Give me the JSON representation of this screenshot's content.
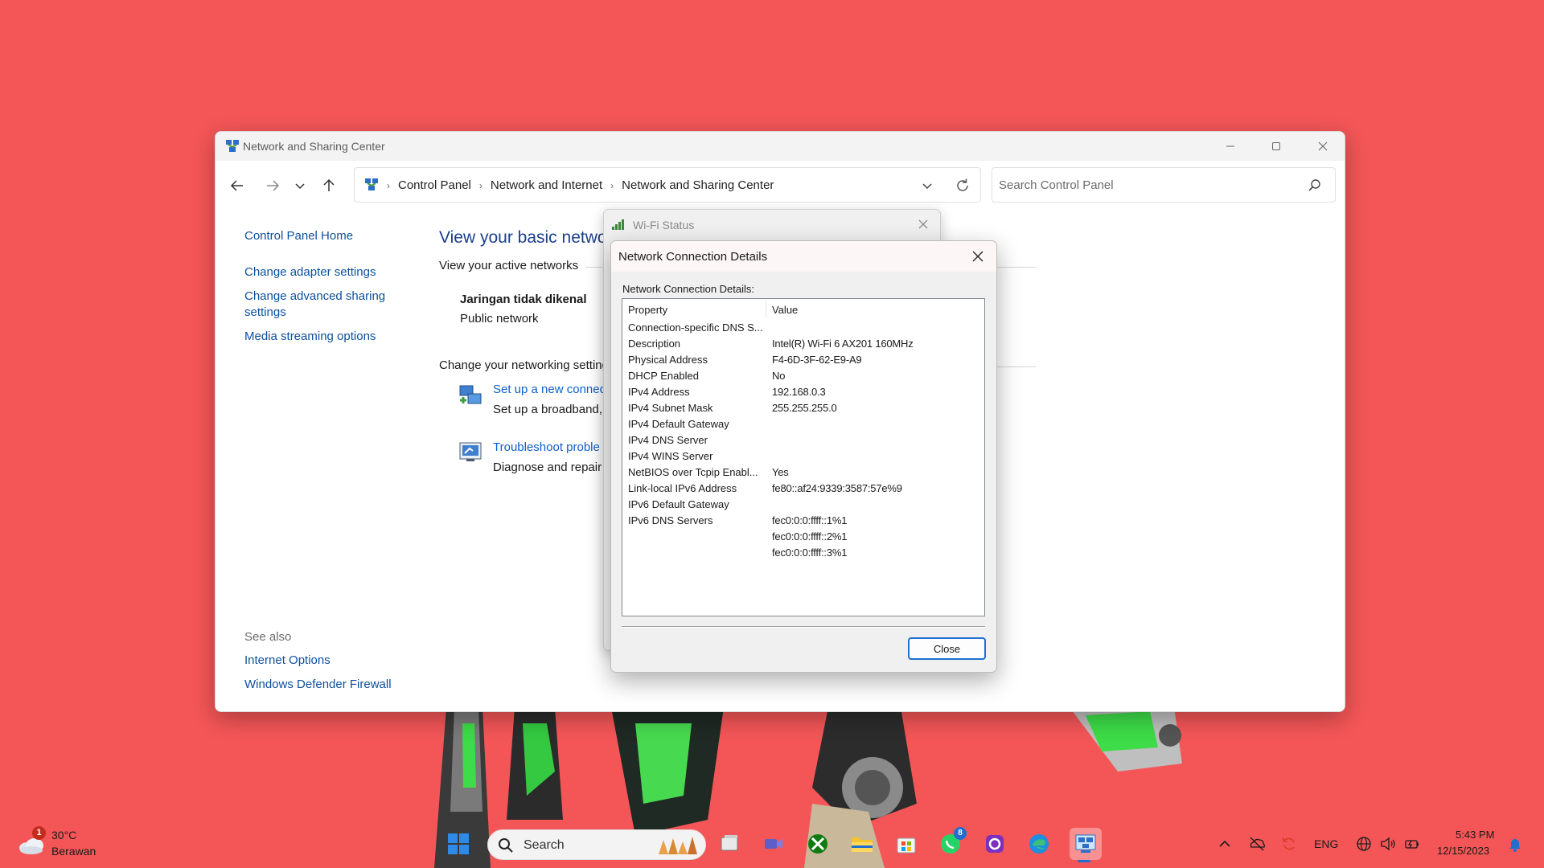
{
  "window": {
    "title": "Network and Sharing Center",
    "breadcrumbs": [
      "Control Panel",
      "Network and Internet",
      "Network and Sharing Center"
    ],
    "search_placeholder": "Search Control Panel"
  },
  "left_pane": {
    "links": [
      "Control Panel Home",
      "Change adapter settings",
      "Change advanced sharing settings",
      "Media streaming options"
    ],
    "see_also_title": "See also",
    "see_also": [
      "Internet Options",
      "Windows Defender Firewall"
    ]
  },
  "content": {
    "heading": "View your basic networ",
    "active_networks_label": "View your active networks",
    "network_name": "Jaringan tidak dikenal",
    "network_type": "Public network",
    "change_settings_label": "Change your networking setting",
    "tasks": [
      {
        "link": "Set up a new connec",
        "desc": "Set up a broadband,"
      },
      {
        "link": "Troubleshoot proble",
        "desc": "Diagnose and repair"
      }
    ]
  },
  "wifi_dialog": {
    "title": "Wi-Fi Status"
  },
  "details_dialog": {
    "title": "Network Connection Details",
    "label": "Network Connection Details:",
    "columns": [
      "Property",
      "Value"
    ],
    "rows": [
      [
        "Connection-specific DNS S...",
        ""
      ],
      [
        "Description",
        "Intel(R) Wi-Fi 6 AX201 160MHz"
      ],
      [
        "Physical Address",
        "F4-6D-3F-62-E9-A9"
      ],
      [
        "DHCP Enabled",
        "No"
      ],
      [
        "IPv4 Address",
        "192.168.0.3"
      ],
      [
        "IPv4 Subnet Mask",
        "255.255.255.0"
      ],
      [
        "IPv4 Default Gateway",
        ""
      ],
      [
        "IPv4 DNS Server",
        ""
      ],
      [
        "IPv4 WINS Server",
        ""
      ],
      [
        "NetBIOS over Tcpip Enabl...",
        "Yes"
      ],
      [
        "Link-local IPv6 Address",
        "fe80::af24:9339:3587:57e%9"
      ],
      [
        "IPv6 Default Gateway",
        ""
      ],
      [
        "IPv6 DNS Servers",
        "fec0:0:0:ffff::1%1"
      ],
      [
        "",
        "fec0:0:0:ffff::2%1"
      ],
      [
        "",
        "fec0:0:0:ffff::3%1"
      ]
    ],
    "close_label": "Close"
  },
  "taskbar": {
    "weather_temp": "30°C",
    "weather_desc": "Berawan",
    "weather_badge": "1",
    "search_label": "Search",
    "whatsapp_badge": "8",
    "language": "ENG",
    "time": "5:43 PM",
    "date": "12/15/2023"
  },
  "colors": {
    "wallpaper": "#f45657",
    "link": "#0d4f9e",
    "heading": "#1c3f8a",
    "accent": "#1f6fd0"
  }
}
